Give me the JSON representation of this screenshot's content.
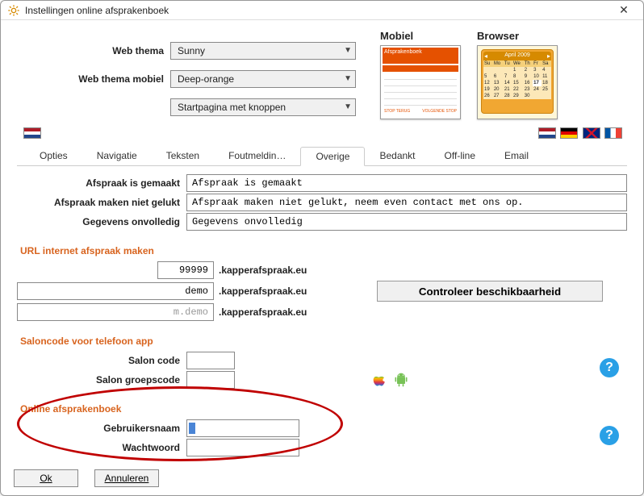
{
  "window": {
    "title": "Instellingen online afsprakenboek"
  },
  "theme": {
    "label_theme": "Web thema",
    "label_theme_mobile": "Web thema mobiel",
    "theme_value": "Sunny",
    "theme_mobile_value": "Deep-orange",
    "startpage_value": "Startpagina met knoppen"
  },
  "previews": {
    "mobile_label": "Mobiel",
    "browser_label": "Browser",
    "calendar_month": "April 2009"
  },
  "tabs": [
    "Opties",
    "Navigatie",
    "Teksten",
    "Foutmeldin…",
    "Overige",
    "Bedankt",
    "Off-line",
    "Email"
  ],
  "active_tab_index": 4,
  "messages": {
    "made_label": "Afspraak is gemaakt",
    "made_value": "Afspraak is gemaakt",
    "failed_label": "Afspraak maken niet gelukt",
    "failed_value": "Afspraak maken niet gelukt, neem even contact met ons op.",
    "incomplete_label": "Gegevens onvolledig",
    "incomplete_value": "Gegevens onvolledig"
  },
  "url_group": {
    "title": "URL internet afspraak maken",
    "code_value": "99999",
    "name_value": "demo",
    "mobile_value": "m.demo",
    "domain": ".kapperafspraak.eu",
    "check_button": "Controleer beschikbaarheid"
  },
  "salon_group": {
    "title": "Saloncode voor telefoon app",
    "code_label": "Salon code",
    "group_label": "Salon groepscode",
    "code_value": "",
    "group_value": ""
  },
  "login_group": {
    "title": "Online afsprakenboek",
    "user_label": "Gebruikersnaam",
    "pass_label": "Wachtwoord",
    "user_value": "",
    "pass_value": ""
  },
  "buttons": {
    "ok": "Ok",
    "cancel": "Annuleren"
  }
}
